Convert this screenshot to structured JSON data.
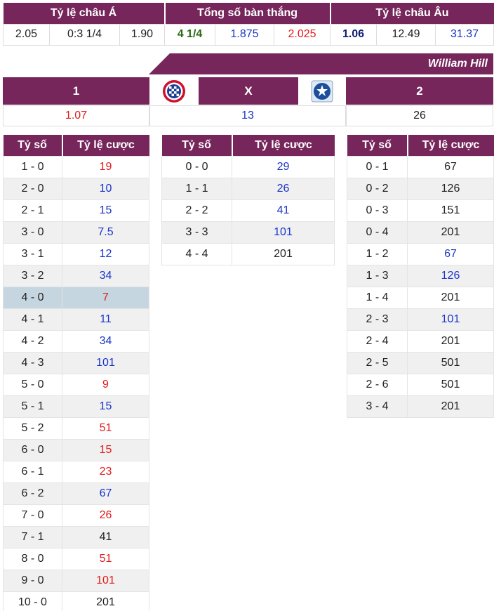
{
  "top": {
    "headers": [
      "Tỷ lệ châu Á",
      "Tổng số bàn thắng",
      "Tỷ lệ châu Âu"
    ],
    "values": [
      {
        "text": "2.05",
        "color": "black"
      },
      {
        "text": "0:3 1/4",
        "color": "black"
      },
      {
        "text": "1.90",
        "color": "black"
      },
      {
        "text": "4 1/4",
        "color": "green"
      },
      {
        "text": "1.875",
        "color": "blue"
      },
      {
        "text": "2.025",
        "color": "red"
      },
      {
        "text": "1.06",
        "color": "navy"
      },
      {
        "text": "12.49",
        "color": "black"
      },
      {
        "text": "31.37",
        "color": "blue"
      }
    ]
  },
  "bookmaker": "William Hill",
  "result": {
    "home_label": "1",
    "draw_label": "X",
    "away_label": "2",
    "home_value": "1.07",
    "draw_value": "13",
    "away_value": "26",
    "home_logo": "bayern-munich-logo",
    "away_logo": "darmstadt-logo"
  },
  "score_header": {
    "score": "Tỷ số",
    "odds": "Tỷ lệ cược"
  },
  "home_scores": [
    {
      "score": "1 - 0",
      "odds": "19",
      "color": "red"
    },
    {
      "score": "2 - 0",
      "odds": "10",
      "color": "blue"
    },
    {
      "score": "2 - 1",
      "odds": "15",
      "color": "blue"
    },
    {
      "score": "3 - 0",
      "odds": "7.5",
      "color": "blue"
    },
    {
      "score": "3 - 1",
      "odds": "12",
      "color": "blue"
    },
    {
      "score": "3 - 2",
      "odds": "34",
      "color": "blue"
    },
    {
      "score": "4 - 0",
      "odds": "7",
      "color": "red",
      "highlight": true
    },
    {
      "score": "4 - 1",
      "odds": "11",
      "color": "blue"
    },
    {
      "score": "4 - 2",
      "odds": "34",
      "color": "blue"
    },
    {
      "score": "4 - 3",
      "odds": "101",
      "color": "blue"
    },
    {
      "score": "5 - 0",
      "odds": "9",
      "color": "red"
    },
    {
      "score": "5 - 1",
      "odds": "15",
      "color": "blue"
    },
    {
      "score": "5 - 2",
      "odds": "51",
      "color": "red"
    },
    {
      "score": "6 - 0",
      "odds": "15",
      "color": "red"
    },
    {
      "score": "6 - 1",
      "odds": "23",
      "color": "red"
    },
    {
      "score": "6 - 2",
      "odds": "67",
      "color": "blue"
    },
    {
      "score": "7 - 0",
      "odds": "26",
      "color": "red"
    },
    {
      "score": "7 - 1",
      "odds": "41",
      "color": "black"
    },
    {
      "score": "8 - 0",
      "odds": "51",
      "color": "red"
    },
    {
      "score": "9 - 0",
      "odds": "101",
      "color": "red"
    },
    {
      "score": "10 - 0",
      "odds": "201",
      "color": "black"
    }
  ],
  "draw_scores": [
    {
      "score": "0 - 0",
      "odds": "29",
      "color": "blue"
    },
    {
      "score": "1 - 1",
      "odds": "26",
      "color": "blue"
    },
    {
      "score": "2 - 2",
      "odds": "41",
      "color": "blue"
    },
    {
      "score": "3 - 3",
      "odds": "101",
      "color": "blue"
    },
    {
      "score": "4 - 4",
      "odds": "201",
      "color": "black"
    }
  ],
  "away_scores": [
    {
      "score": "0 - 1",
      "odds": "67",
      "color": "black"
    },
    {
      "score": "0 - 2",
      "odds": "126",
      "color": "black"
    },
    {
      "score": "0 - 3",
      "odds": "151",
      "color": "black"
    },
    {
      "score": "0 - 4",
      "odds": "201",
      "color": "black"
    },
    {
      "score": "1 - 2",
      "odds": "67",
      "color": "blue"
    },
    {
      "score": "1 - 3",
      "odds": "126",
      "color": "blue"
    },
    {
      "score": "1 - 4",
      "odds": "201",
      "color": "black"
    },
    {
      "score": "2 - 3",
      "odds": "101",
      "color": "blue"
    },
    {
      "score": "2 - 4",
      "odds": "201",
      "color": "black"
    },
    {
      "score": "2 - 5",
      "odds": "501",
      "color": "black"
    },
    {
      "score": "2 - 6",
      "odds": "501",
      "color": "black"
    },
    {
      "score": "3 - 4",
      "odds": "201",
      "color": "black"
    }
  ]
}
